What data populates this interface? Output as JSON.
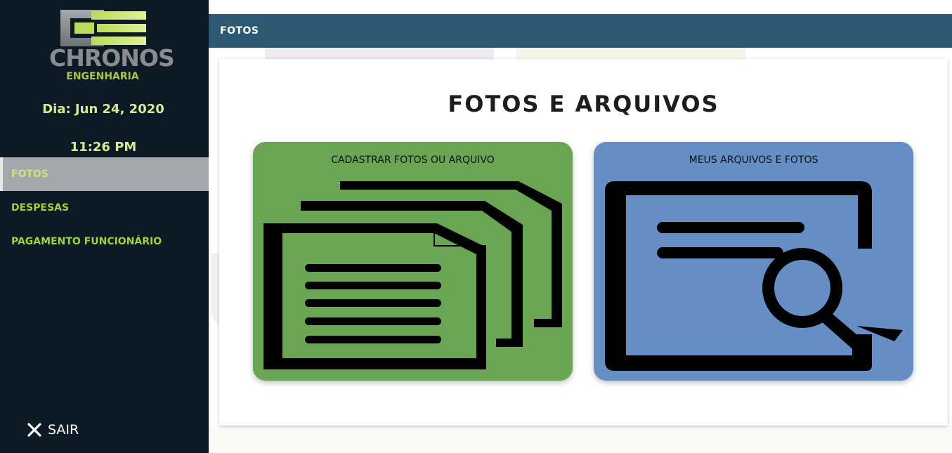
{
  "sidebar": {
    "logo": {
      "name": "CHRONOS",
      "subtitle": "ENGENHARIA",
      "colors": {
        "mark_light": "#d4ec8f",
        "mark_dark": "#9ccc3c",
        "gray": "#8a8c8e"
      }
    },
    "date": "Dia: Jun 24, 2020",
    "time": "11:26 PM",
    "items": [
      {
        "label": "FOTOS",
        "active": true
      },
      {
        "label": "DESPESAS",
        "active": false
      },
      {
        "label": "PAGAMENTO FUNCIONÁRIO",
        "active": false
      }
    ],
    "logout": {
      "label": "SAIR",
      "icon": "close-icon"
    }
  },
  "header": {
    "title": "FOTOS"
  },
  "main": {
    "title": "FOTOS E ARQUIVOS",
    "cards": [
      {
        "label": "CADASTRAR FOTOS OU ARQUIVO",
        "icon": "documents-icon",
        "color": "#6aa553"
      },
      {
        "label": "MEUS ARQUIVOS E FOTOS",
        "icon": "file-search-icon",
        "color": "#648ec4"
      }
    ]
  },
  "colors": {
    "sidebar_bg": "#0b1a24",
    "header_bg": "#2b5a70",
    "nav_text": "#9ed43a",
    "nav_active_bg": "#a4a7ab"
  }
}
